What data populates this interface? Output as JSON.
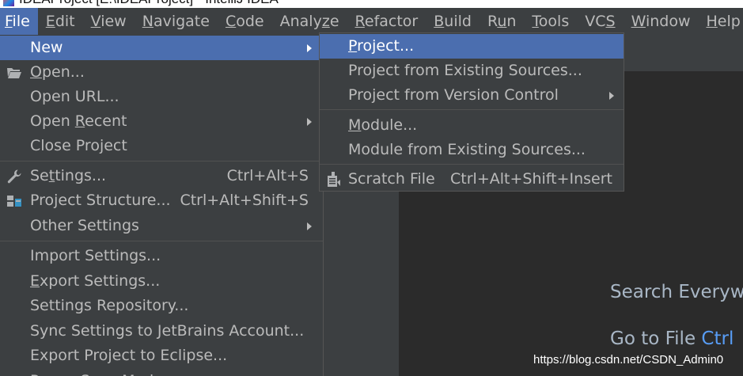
{
  "window": {
    "title": "IDEAProject [E:\\IDEAProject] - IntelliJ IDEA"
  },
  "menubar": {
    "items": [
      "File",
      "Edit",
      "View",
      "Navigate",
      "Code",
      "Analyze",
      "Refactor",
      "Build",
      "Run",
      "Tools",
      "VCS",
      "Window",
      "Help"
    ],
    "active": "File"
  },
  "file_menu": {
    "new": "New",
    "open": "Open...",
    "open_url": "Open URL...",
    "open_recent": "Open Recent",
    "close_project": "Close Project",
    "settings": "Settings...",
    "settings_shortcut": "Ctrl+Alt+S",
    "project_structure": "Project Structure...",
    "project_structure_shortcut": "Ctrl+Alt+Shift+S",
    "other_settings": "Other Settings",
    "import_settings": "Import Settings...",
    "export_settings": "Export Settings...",
    "settings_repository": "Settings Repository...",
    "sync_settings": "Sync Settings to JetBrains Account...",
    "export_eclipse": "Export Project to Eclipse...",
    "power_save": "Power Save Mode"
  },
  "new_submenu": {
    "project": "Project...",
    "project_existing": "Project from Existing Sources...",
    "project_vcs": "Project from Version Control",
    "module": "Module...",
    "module_existing": "Module from Existing Sources...",
    "scratch_file": "Scratch File",
    "scratch_shortcut": "Ctrl+Alt+Shift+Insert"
  },
  "editor_hints": {
    "search_everywhere": "Search Everywh",
    "go_to_file": "Go to File",
    "go_to_file_key": "Ctrl"
  },
  "watermark": "https://blog.csdn.net/CSDN_Admin0",
  "colors": {
    "menu_bg": "#3c3f41",
    "selection": "#4b6eaf",
    "editor_bg": "#2b2b2b",
    "text": "#bbbbbb",
    "key_accent": "#589df6"
  }
}
